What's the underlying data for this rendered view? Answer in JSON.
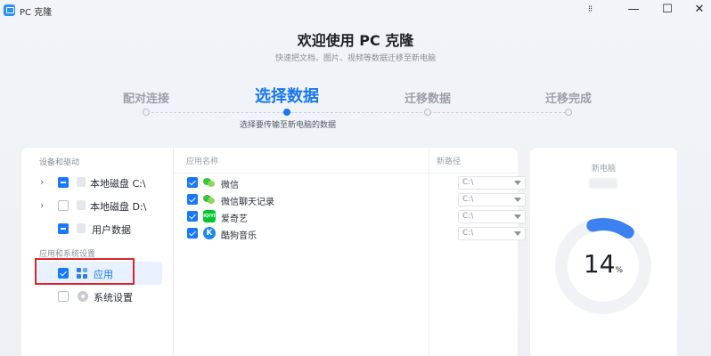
{
  "titlebar": {
    "app_title": "PC 克隆",
    "menu_glyph": "⁝⁝",
    "minimize_glyph": "—",
    "maximize_glyph": "☐",
    "close_glyph": "✕"
  },
  "header": {
    "title": "欢迎使用 PC 克隆",
    "subtitle": "快速把文档、图片、视频等数据迁移至新电脑"
  },
  "steps": [
    {
      "label": "配对连接",
      "active": false
    },
    {
      "label": "选择数据",
      "active": true
    },
    {
      "label": "迁移数据",
      "active": false
    },
    {
      "label": "迁移完成",
      "active": false
    }
  ],
  "step_description": "选择要传输至新电脑的数据",
  "left_panel": {
    "section_devices": "设备和驱动",
    "devices": [
      {
        "label": "本地磁盘 C:\\",
        "state": "partial",
        "icon": "disk-icon"
      },
      {
        "label": "本地磁盘 D:\\",
        "state": "unchecked",
        "icon": "disk-icon"
      },
      {
        "label": "用户数据",
        "state": "partial",
        "icon": "user-icon"
      }
    ],
    "section_apps": "应用和系统设置",
    "app_items": [
      {
        "label": "应用",
        "state": "checked",
        "icon": "apps-icon",
        "selected": true
      },
      {
        "label": "系统设置",
        "state": "unchecked",
        "icon": "gear-icon",
        "selected": false
      }
    ]
  },
  "app_table": {
    "col_name": "应用名称",
    "col_path": "新路径",
    "rows": [
      {
        "name": "微信",
        "path": "C:\\",
        "icon": "wechat-icon",
        "checked": true
      },
      {
        "name": "微信聊天记录",
        "path": "C:\\",
        "icon": "wechat-icon",
        "checked": true
      },
      {
        "name": "爱奇艺",
        "path": "C:\\",
        "icon": "iqiyi-icon",
        "icon_text": "iQIYI",
        "checked": true
      },
      {
        "name": "酷狗音乐",
        "path": "C:\\",
        "icon": "kugou-icon",
        "icon_text": "K",
        "checked": true
      }
    ]
  },
  "new_pc": {
    "title": "新电脑",
    "progress_value": "14",
    "progress_unit": "%",
    "progress_fraction": 0.14,
    "accent_color": "#3b82f0",
    "track_color": "#f0f2f5"
  }
}
